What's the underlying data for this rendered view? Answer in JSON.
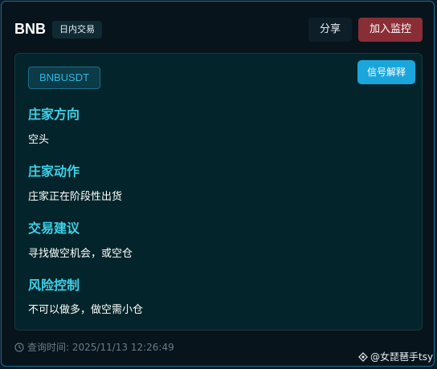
{
  "header": {
    "symbol": "BNB",
    "mode_tag": "日内交易",
    "share_label": "分享",
    "monitor_label": "加入监控"
  },
  "card": {
    "pair": "BNBUSDT",
    "explain_label": "信号解释",
    "sections": [
      {
        "title": "庄家方向",
        "text": "空头"
      },
      {
        "title": "庄家动作",
        "text": "庄家正在阶段性出货"
      },
      {
        "title": "交易建议",
        "text": "寻找做空机会，或空仓"
      },
      {
        "title": "风险控制",
        "text": "不可以做多，做空需小仓"
      }
    ]
  },
  "footer": {
    "query_time": "查询时间: 2025/11/13 12:26:49",
    "watermark": "@女琵琶手tsy"
  },
  "colors": {
    "accent": "#3fd0e8",
    "monitor_button": "#8a2e36",
    "explain_button": "#1aa6dd",
    "card_background": "#03242a"
  },
  "icons": [
    "clock-icon",
    "watermark-logo-icon"
  ]
}
